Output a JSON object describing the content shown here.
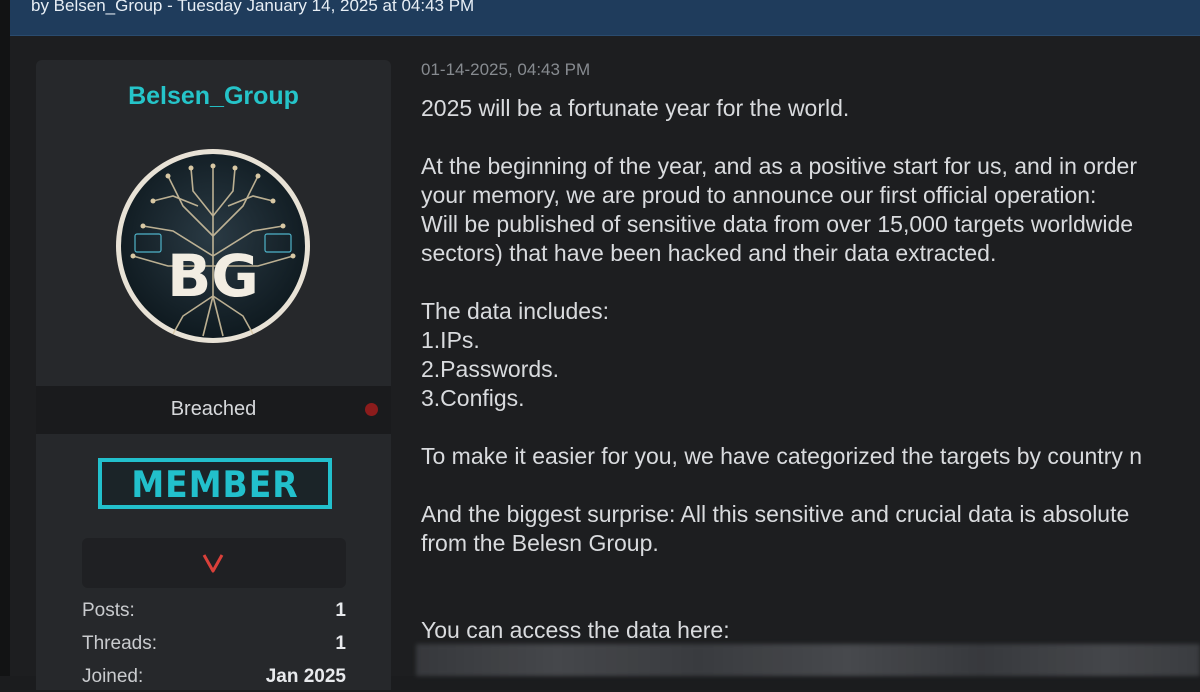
{
  "header": {
    "byline": "by Belsen_Group - Tuesday January 14, 2025 at 04:43 PM"
  },
  "user": {
    "username": "Belsen_Group",
    "avatar_initials": "BG",
    "status": "Breached",
    "rank": "MEMBER",
    "stats": [
      {
        "label": "Posts:",
        "value": "1"
      },
      {
        "label": "Threads:",
        "value": "1"
      },
      {
        "label": "Joined:",
        "value": "Jan 2025"
      }
    ]
  },
  "post": {
    "date": "01-14-2025, 04:43 PM",
    "lines": [
      "2025 will be a fortunate year for the world.",
      "",
      "At the beginning of the year, and as a positive start for us, and in order",
      "your memory, we are proud to announce our first official operation:",
      "Will be published of sensitive data from over 15,000 targets worldwide",
      "sectors) that have been hacked and their data extracted.",
      "",
      "The data includes:",
      "1.IPs.",
      "2.Passwords.",
      "3.Configs.",
      "",
      "To make it easier for you, we have categorized the targets by country n",
      "",
      "And the biggest surprise: All this sensitive and crucial data is absolute",
      "from the Belesn Group.",
      "",
      "",
      "You can access the data here:"
    ]
  },
  "colors": {
    "header_bg": "#1f3c5c",
    "username": "#25c4c9",
    "rank_accent": "#22c0cc",
    "status_dot": "#8c1c1c",
    "award_icon": "#d9403a"
  }
}
